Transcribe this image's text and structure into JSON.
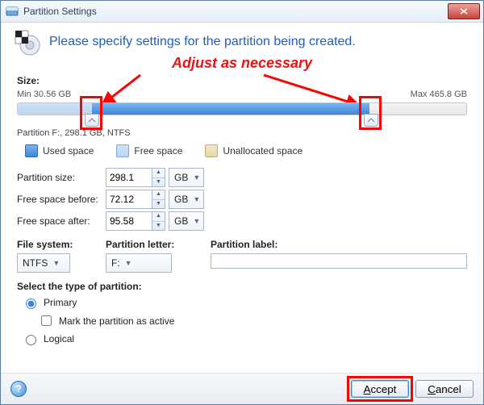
{
  "window": {
    "title": "Partition Settings"
  },
  "header": {
    "heading": "Please specify settings for the partition being created."
  },
  "annotation": {
    "text": "Adjust as necessary"
  },
  "size": {
    "label": "Size:",
    "min_label": "Min 30.56 GB",
    "max_label": "Max 465.8 GB",
    "caption": "Partition F:, 298.1 GB, NTFS"
  },
  "legend": {
    "used": "Used space",
    "free": "Free space",
    "unalloc": "Unallocated space"
  },
  "fields": {
    "partition_size": {
      "label": "Partition size:",
      "value": "298.1",
      "unit": "GB"
    },
    "free_before": {
      "label": "Free space before:",
      "value": "72.12",
      "unit": "GB"
    },
    "free_after": {
      "label": "Free space after:",
      "value": "95.58",
      "unit": "GB"
    }
  },
  "filesys": {
    "fs_label": "File system:",
    "fs_value": "NTFS",
    "letter_label": "Partition letter:",
    "letter_value": "F:",
    "plabel_label": "Partition label:",
    "plabel_value": ""
  },
  "type": {
    "header": "Select the type of partition:",
    "primary": "Primary",
    "mark_active": "Mark the partition as active",
    "logical": "Logical"
  },
  "footer": {
    "accept": "Accept",
    "cancel": "Cancel"
  },
  "colors": {
    "annotation_red": "#ff0000",
    "heading_blue": "#1d5ebe",
    "used_fill": "#3d86d6"
  }
}
